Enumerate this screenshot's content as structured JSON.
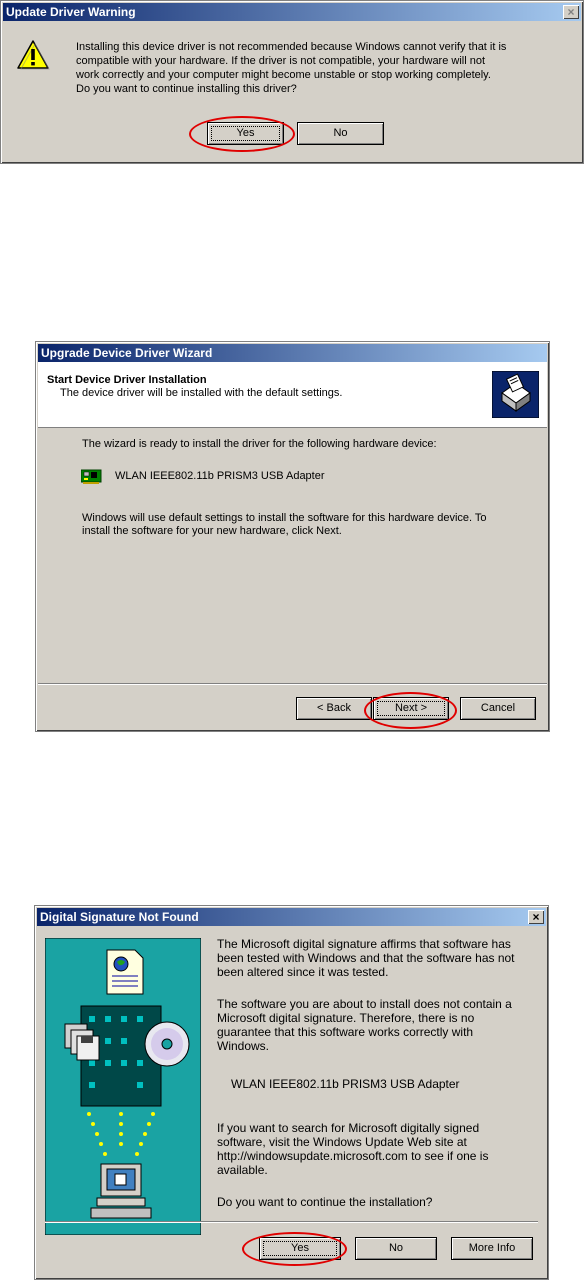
{
  "dialog1": {
    "title": "Update Driver Warning",
    "message_lines": [
      "Installing this device driver is not recommended because Windows cannot verify that it is",
      "compatible with your hardware.  If the driver is not compatible, your hardware will not",
      "work correctly and your computer might become unstable or stop working completely.",
      "Do you want to continue installing this driver?"
    ],
    "yes_label": "Yes",
    "no_label": "No",
    "close_glyph": "×",
    "icon": "warning-icon"
  },
  "dialog2": {
    "title": "Upgrade Device Driver Wizard",
    "header_title": "Start Device Driver Installation",
    "header_subtitle": "The device driver will be installed with the default settings.",
    "intro": "The wizard is ready to install the driver for the following hardware device:",
    "device_name": "WLAN IEEE802.11b PRISM3 USB Adapter",
    "body_lines": [
      "Windows will use default settings to install the software for this hardware device. To",
      "install the software for your new hardware, click Next."
    ],
    "back_label": "< Back",
    "next_label": "Next >",
    "cancel_label": "Cancel",
    "icons": [
      "wizard-hardware-icon",
      "network-card-icon"
    ]
  },
  "dialog3": {
    "title": "Digital Signature Not Found",
    "para1_lines": [
      "The Microsoft digital signature affirms that software has",
      "been tested with Windows and that the software has not",
      "been altered since it was tested."
    ],
    "para2_lines": [
      "The software you are about to install does not contain a",
      "Microsoft digital signature. Therefore,  there is no",
      "guarantee that this software works correctly with",
      "Windows."
    ],
    "device_name": "WLAN IEEE802.11b PRISM3 USB Adapter",
    "para3_lines": [
      "If you want to search for Microsoft digitally signed",
      "software, visit the Windows Update Web site at",
      "http://windowsupdate.microsoft.com to see if one is",
      "available."
    ],
    "question": "Do you want to continue the installation?",
    "yes_label": "Yes",
    "no_label": "No",
    "more_info_label": "More Info",
    "close_glyph": "×",
    "illustration": "signature-illustration-icon"
  },
  "colors": {
    "title_active": "#0a246a",
    "face": "#d4d0c8",
    "highlight_ring": "#e00000",
    "illustration_bg": "#1aa3a3"
  }
}
